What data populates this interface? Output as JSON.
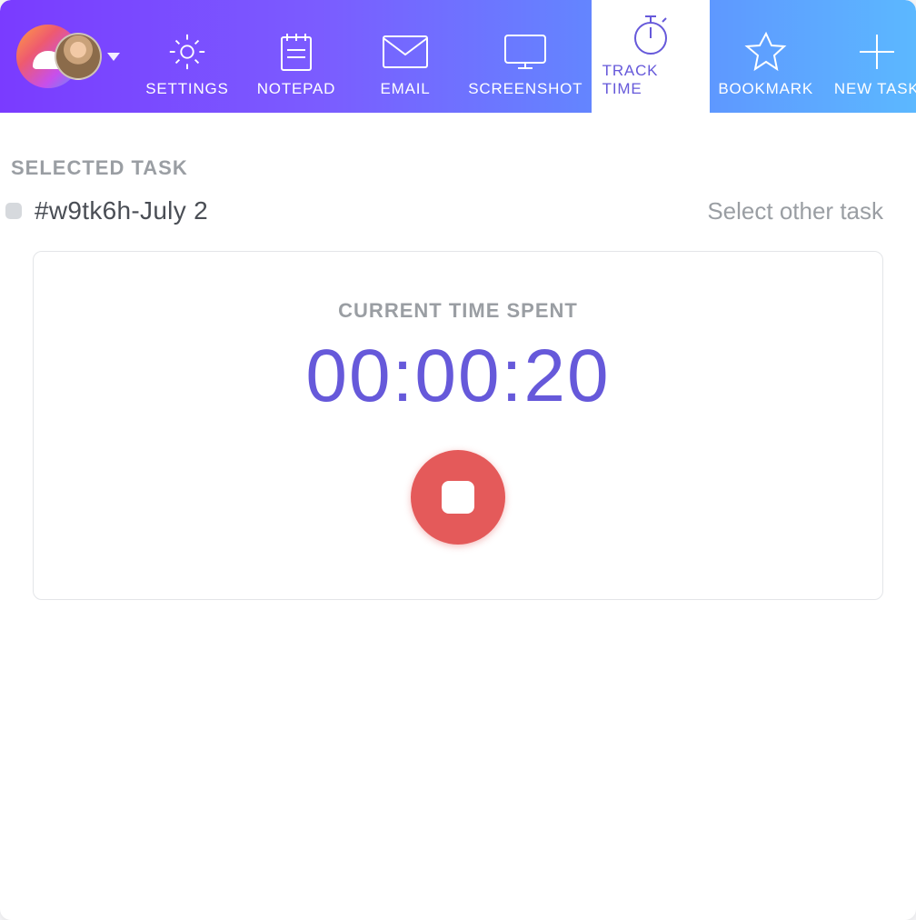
{
  "topbar": {
    "tabs": [
      {
        "label": "SETTINGS",
        "icon": "gear-icon",
        "active": false
      },
      {
        "label": "NOTEPAD",
        "icon": "notepad-icon",
        "active": false
      },
      {
        "label": "EMAIL",
        "icon": "email-icon",
        "active": false
      },
      {
        "label": "SCREENSHOT",
        "icon": "screenshot-icon",
        "active": false
      },
      {
        "label": "TRACK TIME",
        "icon": "stopwatch-icon",
        "active": true
      },
      {
        "label": "BOOKMARK",
        "icon": "star-icon",
        "active": false
      },
      {
        "label": "NEW TASK",
        "icon": "plus-icon",
        "active": false
      }
    ]
  },
  "content": {
    "section_label": "SELECTED TASK",
    "task_name": "#w9tk6h-July 2",
    "select_other_label": "Select other task",
    "timer_label": "CURRENT TIME SPENT",
    "timer_value": "00:00:20"
  },
  "colors": {
    "accent": "#6659da",
    "stop_button": "#e45a5a"
  }
}
